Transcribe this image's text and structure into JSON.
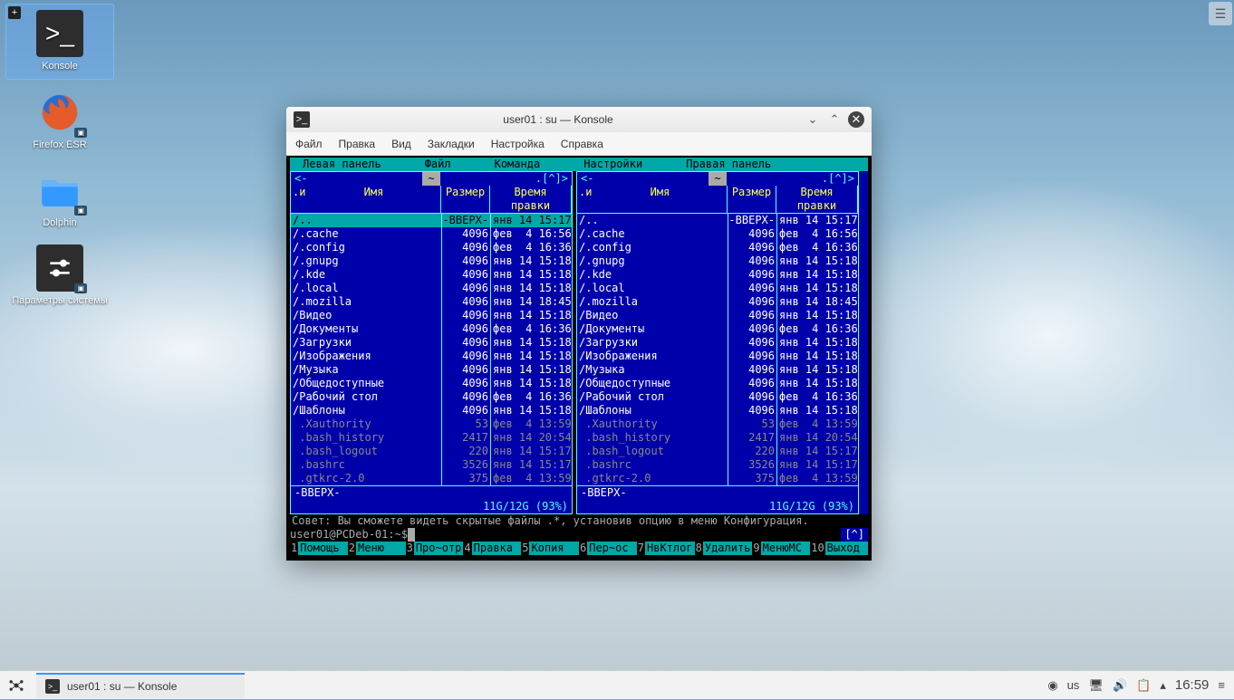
{
  "desktop": {
    "icons": [
      {
        "name": "Konsole"
      },
      {
        "name": "Firefox ESR"
      },
      {
        "name": "Dolphin"
      },
      {
        "name": "Параметры системы"
      }
    ]
  },
  "window": {
    "title": "user01 : su — Konsole",
    "menubar": [
      "Файл",
      "Правка",
      "Вид",
      "Закладки",
      "Настройка",
      "Справка"
    ]
  },
  "mc": {
    "topmenu": [
      "Левая панель",
      "Файл",
      "Команда",
      "Настройки",
      "Правая панель"
    ],
    "path": "~",
    "corner_left": "<-",
    "corner_right": ".[^]>",
    "columns": {
      "sort": ".и",
      "name": "Имя",
      "size": "Размер",
      "date": "Время правки"
    },
    "rows": [
      {
        "name": "/..",
        "size": "-ВВЕРХ-",
        "date": "янв 14 15:17",
        "sel": true
      },
      {
        "name": "/.cache",
        "size": "4096",
        "date": "фев  4 16:56"
      },
      {
        "name": "/.config",
        "size": "4096",
        "date": "фев  4 16:36"
      },
      {
        "name": "/.gnupg",
        "size": "4096",
        "date": "янв 14 15:18"
      },
      {
        "name": "/.kde",
        "size": "4096",
        "date": "янв 14 15:18"
      },
      {
        "name": "/.local",
        "size": "4096",
        "date": "янв 14 15:18"
      },
      {
        "name": "/.mozilla",
        "size": "4096",
        "date": "янв 14 18:45"
      },
      {
        "name": "/Видео",
        "size": "4096",
        "date": "янв 14 15:18"
      },
      {
        "name": "/Документы",
        "size": "4096",
        "date": "фев  4 16:36"
      },
      {
        "name": "/Загрузки",
        "size": "4096",
        "date": "янв 14 15:18"
      },
      {
        "name": "/Изображения",
        "size": "4096",
        "date": "янв 14 15:18"
      },
      {
        "name": "/Музыка",
        "size": "4096",
        "date": "янв 14 15:18"
      },
      {
        "name": "/Общедоступные",
        "size": "4096",
        "date": "янв 14 15:18"
      },
      {
        "name": "/Рабочий стол",
        "size": "4096",
        "date": "фев  4 16:36"
      },
      {
        "name": "/Шаблоны",
        "size": "4096",
        "date": "янв 14 15:18"
      },
      {
        "name": " .Xauthority",
        "size": "53",
        "date": "фев  4 13:59",
        "hidden": true
      },
      {
        "name": " .bash_history",
        "size": "2417",
        "date": "янв 14 20:54",
        "hidden": true
      },
      {
        "name": " .bash_logout",
        "size": "220",
        "date": "янв 14 15:17",
        "hidden": true
      },
      {
        "name": " .bashrc",
        "size": "3526",
        "date": "янв 14 15:17",
        "hidden": true
      },
      {
        "name": " .gtkrc-2.0",
        "size": "375",
        "date": "фев  4 13:59",
        "hidden": true
      }
    ],
    "rows_right": [
      {
        "name": "/..",
        "size": "-ВВЕРХ-",
        "date": "янв 14 15:17"
      },
      {
        "name": "/.cache",
        "size": "4096",
        "date": "фев  4 16:56"
      },
      {
        "name": "/.config",
        "size": "4096",
        "date": "фев  4 16:36"
      },
      {
        "name": "/.gnupg",
        "size": "4096",
        "date": "янв 14 15:18"
      },
      {
        "name": "/.kde",
        "size": "4096",
        "date": "янв 14 15:18"
      },
      {
        "name": "/.local",
        "size": "4096",
        "date": "янв 14 15:18"
      },
      {
        "name": "/.mozilla",
        "size": "4096",
        "date": "янв 14 18:45"
      },
      {
        "name": "/Видео",
        "size": "4096",
        "date": "янв 14 15:18"
      },
      {
        "name": "/Документы",
        "size": "4096",
        "date": "фев  4 16:36"
      },
      {
        "name": "/Загрузки",
        "size": "4096",
        "date": "янв 14 15:18"
      },
      {
        "name": "/Изображения",
        "size": "4096",
        "date": "янв 14 15:18"
      },
      {
        "name": "/Музыка",
        "size": "4096",
        "date": "янв 14 15:18"
      },
      {
        "name": "/Общедоступные",
        "size": "4096",
        "date": "янв 14 15:18"
      },
      {
        "name": "/Рабочий стол",
        "size": "4096",
        "date": "фев  4 16:36"
      },
      {
        "name": "/Шаблоны",
        "size": "4096",
        "date": "янв 14 15:18"
      },
      {
        "name": " .Xauthority",
        "size": "53",
        "date": "фев  4 13:59",
        "hidden": true
      },
      {
        "name": " .bash_history",
        "size": "2417",
        "date": "янв 14 20:54",
        "hidden": true
      },
      {
        "name": " .bash_logout",
        "size": "220",
        "date": "янв 14 15:17",
        "hidden": true
      },
      {
        "name": " .bashrc",
        "size": "3526",
        "date": "янв 14 15:17",
        "hidden": true
      },
      {
        "name": " .gtkrc-2.0",
        "size": "375",
        "date": "фев  4 13:59",
        "hidden": true
      }
    ],
    "footer_status": "-ВВЕРХ-",
    "disk": "11G/12G (93%)",
    "hint": "Совет: Вы сможете видеть скрытые файлы .*, установив опцию в меню Конфигурация.",
    "prompt": "user01@PCDeb-01:~$ ",
    "prompt_right": "[^]",
    "fkeys": [
      {
        "n": "1",
        "l": "Помощь"
      },
      {
        "n": "2",
        "l": "Меню"
      },
      {
        "n": "3",
        "l": "Про~отр"
      },
      {
        "n": "4",
        "l": "Правка"
      },
      {
        "n": "5",
        "l": "Копия"
      },
      {
        "n": "6",
        "l": "Пер~ос"
      },
      {
        "n": "7",
        "l": "НвКтлог"
      },
      {
        "n": "8",
        "l": "Удалить"
      },
      {
        "n": "9",
        "l": "МенюMC"
      },
      {
        "n": "10",
        "l": "Выход"
      }
    ]
  },
  "taskbar": {
    "task_label": "user01 : su — Konsole",
    "layout": "us",
    "clock": "16:59"
  }
}
